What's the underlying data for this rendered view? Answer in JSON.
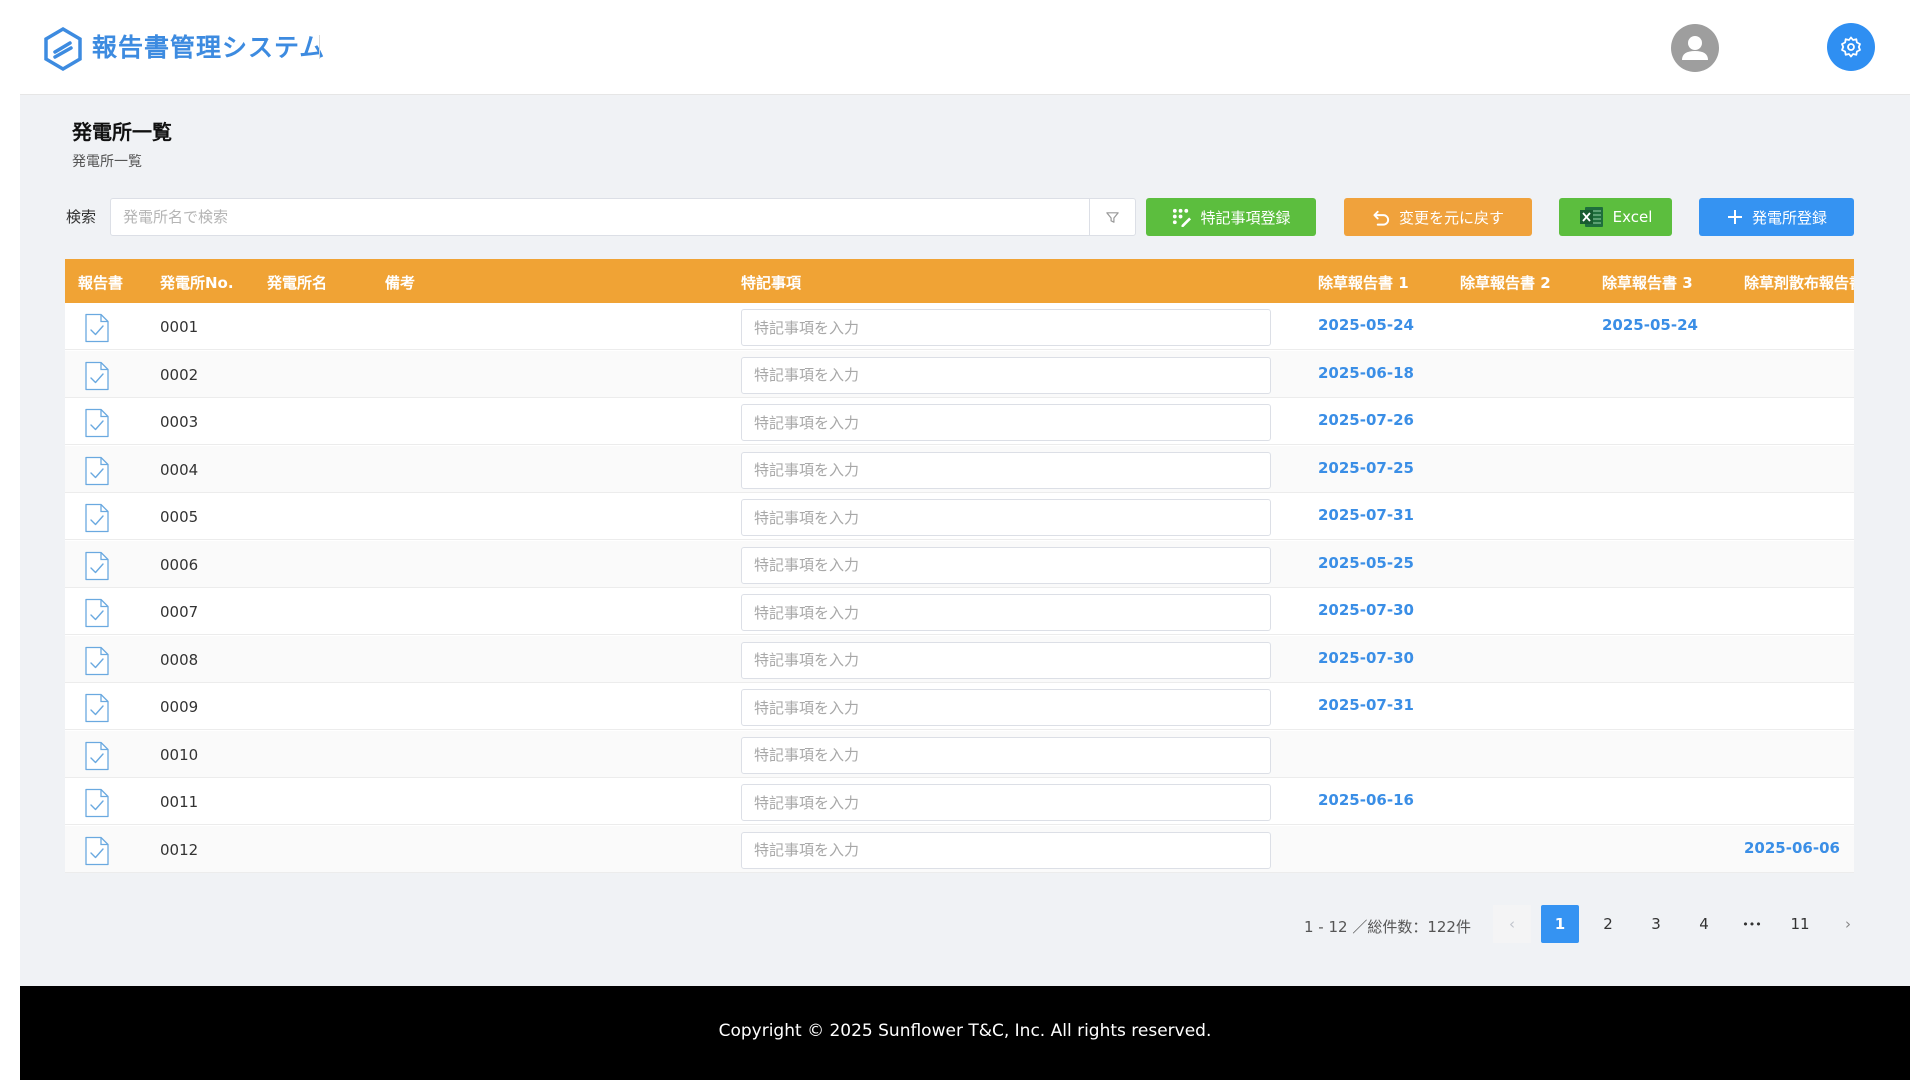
{
  "app": {
    "title": "報告書管理システム"
  },
  "page": {
    "title": "発電所一覧",
    "subtitle": "発電所一覧"
  },
  "toolbar": {
    "search_label": "検索",
    "search_placeholder": "発電所名で検索",
    "search_value": "",
    "btn_special": "特記事項登録",
    "btn_revert": "変更を元に戻す",
    "btn_excel": "Excel",
    "btn_register": "発電所登録"
  },
  "table": {
    "headers": {
      "report": "報告書",
      "plant_no": "発電所No.",
      "plant_name": "発電所名",
      "remarks": "備考",
      "special": "特記事項",
      "weed1": "除草報告書 1",
      "weed2": "除草報告書 2",
      "weed3": "除草報告書 3",
      "herbicide": "除草剤散布報告書"
    },
    "note_placeholder": "特記事項を入力",
    "rows": [
      {
        "no": "0001",
        "name": "",
        "remarks": "",
        "note": "",
        "weed1": "2025-05-24",
        "weed2": "",
        "weed3": "2025-05-24",
        "herbicide": ""
      },
      {
        "no": "0002",
        "name": "",
        "remarks": "",
        "note": "",
        "weed1": "2025-06-18",
        "weed2": "",
        "weed3": "",
        "herbicide": ""
      },
      {
        "no": "0003",
        "name": "",
        "remarks": "",
        "note": "",
        "weed1": "2025-07-26",
        "weed2": "",
        "weed3": "",
        "herbicide": ""
      },
      {
        "no": "0004",
        "name": "",
        "remarks": "",
        "note": "",
        "weed1": "2025-07-25",
        "weed2": "",
        "weed3": "",
        "herbicide": ""
      },
      {
        "no": "0005",
        "name": "",
        "remarks": "",
        "note": "",
        "weed1": "2025-07-31",
        "weed2": "",
        "weed3": "",
        "herbicide": ""
      },
      {
        "no": "0006",
        "name": "",
        "remarks": "",
        "note": "",
        "weed1": "2025-05-25",
        "weed2": "",
        "weed3": "",
        "herbicide": ""
      },
      {
        "no": "0007",
        "name": "",
        "remarks": "",
        "note": "",
        "weed1": "2025-07-30",
        "weed2": "",
        "weed3": "",
        "herbicide": ""
      },
      {
        "no": "0008",
        "name": "",
        "remarks": "",
        "note": "",
        "weed1": "2025-07-30",
        "weed2": "",
        "weed3": "",
        "herbicide": ""
      },
      {
        "no": "0009",
        "name": "",
        "remarks": "",
        "note": "",
        "weed1": "2025-07-31",
        "weed2": "",
        "weed3": "",
        "herbicide": ""
      },
      {
        "no": "0010",
        "name": "",
        "remarks": "",
        "note": "",
        "weed1": "",
        "weed2": "",
        "weed3": "",
        "herbicide": ""
      },
      {
        "no": "0011",
        "name": "",
        "remarks": "",
        "note": "",
        "weed1": "2025-06-16",
        "weed2": "",
        "weed3": "",
        "herbicide": ""
      },
      {
        "no": "0012",
        "name": "",
        "remarks": "",
        "note": "",
        "weed1": "",
        "weed2": "",
        "weed3": "",
        "herbicide": "2025-06-06"
      }
    ]
  },
  "pagination": {
    "total_text": "1 - 12 ／総件数：122件",
    "prev": "‹",
    "pages": [
      "1",
      "2",
      "3",
      "4"
    ],
    "ellipsis": "•••",
    "last": "11",
    "next": "›",
    "current": "1"
  },
  "footer": {
    "copyright": "Copyright © 2025 Sunflower T&C, Inc. All rights reserved."
  },
  "colors": {
    "header_orange": "#f0a335",
    "link_blue": "#3a8ee6",
    "btn_green": "#5cbe3e",
    "btn_orange": "#f0a23c",
    "btn_blue": "#3593f2",
    "footer_black": "#000000"
  },
  "icons": [
    "logo-icon",
    "avatar-icon",
    "gear-icon",
    "filter-icon",
    "special-note-icon",
    "undo-icon",
    "excel-icon",
    "plus-icon",
    "document-check-icon"
  ]
}
